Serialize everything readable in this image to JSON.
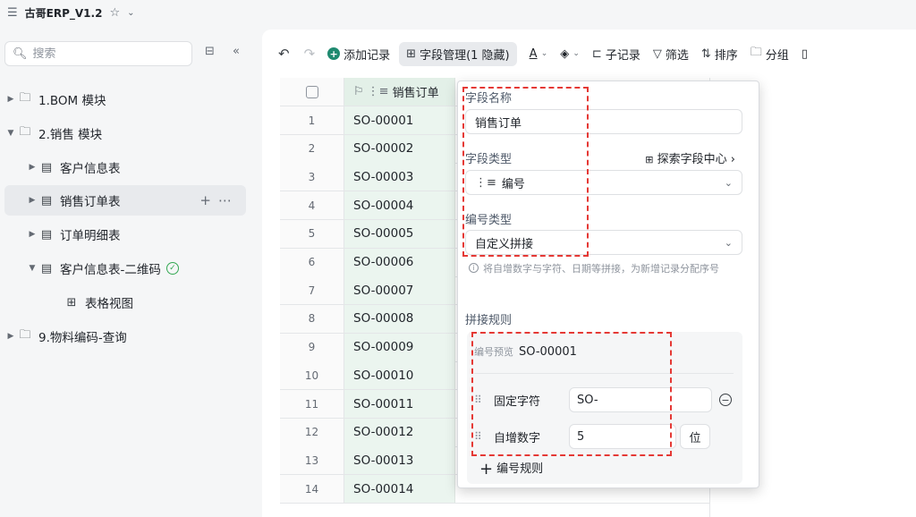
{
  "app": {
    "menu_icon": "menu-icon",
    "title": "古哥ERP_V1.2",
    "star_icon": "star-icon",
    "dropdown_icon": "chevron-down-icon"
  },
  "sidebar": {
    "search_placeholder": "搜索",
    "items": [
      {
        "label": "1.BOM 模块",
        "icon": "folder-icon"
      },
      {
        "label": "2.销售 模块",
        "icon": "folder-icon"
      },
      {
        "label": "客户信息表",
        "icon": "table-icon"
      },
      {
        "label": "销售订单表",
        "icon": "table-icon"
      },
      {
        "label": "订单明细表",
        "icon": "table-icon"
      },
      {
        "label": "客户信息表-二维码",
        "icon": "table-linked-icon"
      },
      {
        "label": "表格视图",
        "icon": "grid-view-icon"
      },
      {
        "label": "9.物料编码-查询",
        "icon": "folder-icon"
      }
    ]
  },
  "toolbar": {
    "add_record": "添加记录",
    "field_manage": "字段管理(1 隐藏)",
    "sub_record": "子记录",
    "filter": "筛选",
    "sort": "排序",
    "group": "分组"
  },
  "table": {
    "column_header": "销售订单",
    "rows": [
      {
        "n": "1",
        "v": "SO-00001"
      },
      {
        "n": "2",
        "v": "SO-00002"
      },
      {
        "n": "3",
        "v": "SO-00003"
      },
      {
        "n": "4",
        "v": "SO-00004"
      },
      {
        "n": "5",
        "v": "SO-00005"
      },
      {
        "n": "6",
        "v": "SO-00006"
      },
      {
        "n": "7",
        "v": "SO-00007"
      },
      {
        "n": "8",
        "v": "SO-00008"
      },
      {
        "n": "9",
        "v": "SO-00009"
      },
      {
        "n": "10",
        "v": "SO-00010"
      },
      {
        "n": "11",
        "v": "SO-00011"
      },
      {
        "n": "12",
        "v": "SO-00012"
      },
      {
        "n": "13",
        "v": "SO-00013"
      },
      {
        "n": "14",
        "v": "SO-00014"
      }
    ]
  },
  "panel": {
    "field_name_label": "字段名称",
    "field_name_value": "销售订单",
    "field_type_label": "字段类型",
    "explore_link": "探索字段中心",
    "field_type_value": "编号",
    "number_type_label": "编号类型",
    "number_type_value": "自定义拼接",
    "hint": "将自增数字与字符、日期等拼接，为新增记录分配序号",
    "rules_label": "拼接规则",
    "preview_label": "编号预览",
    "preview_value": "SO-00001",
    "rule1_name": "固定字符",
    "rule1_value": "SO-",
    "rule2_name": "自增数字",
    "rule2_value": "5",
    "rule2_unit": "位",
    "add_rule": "编号规则"
  },
  "colors": {
    "accent_green": "#1f8a70",
    "highlight_red": "#e53935",
    "column_fill": "#ebf5ef"
  }
}
